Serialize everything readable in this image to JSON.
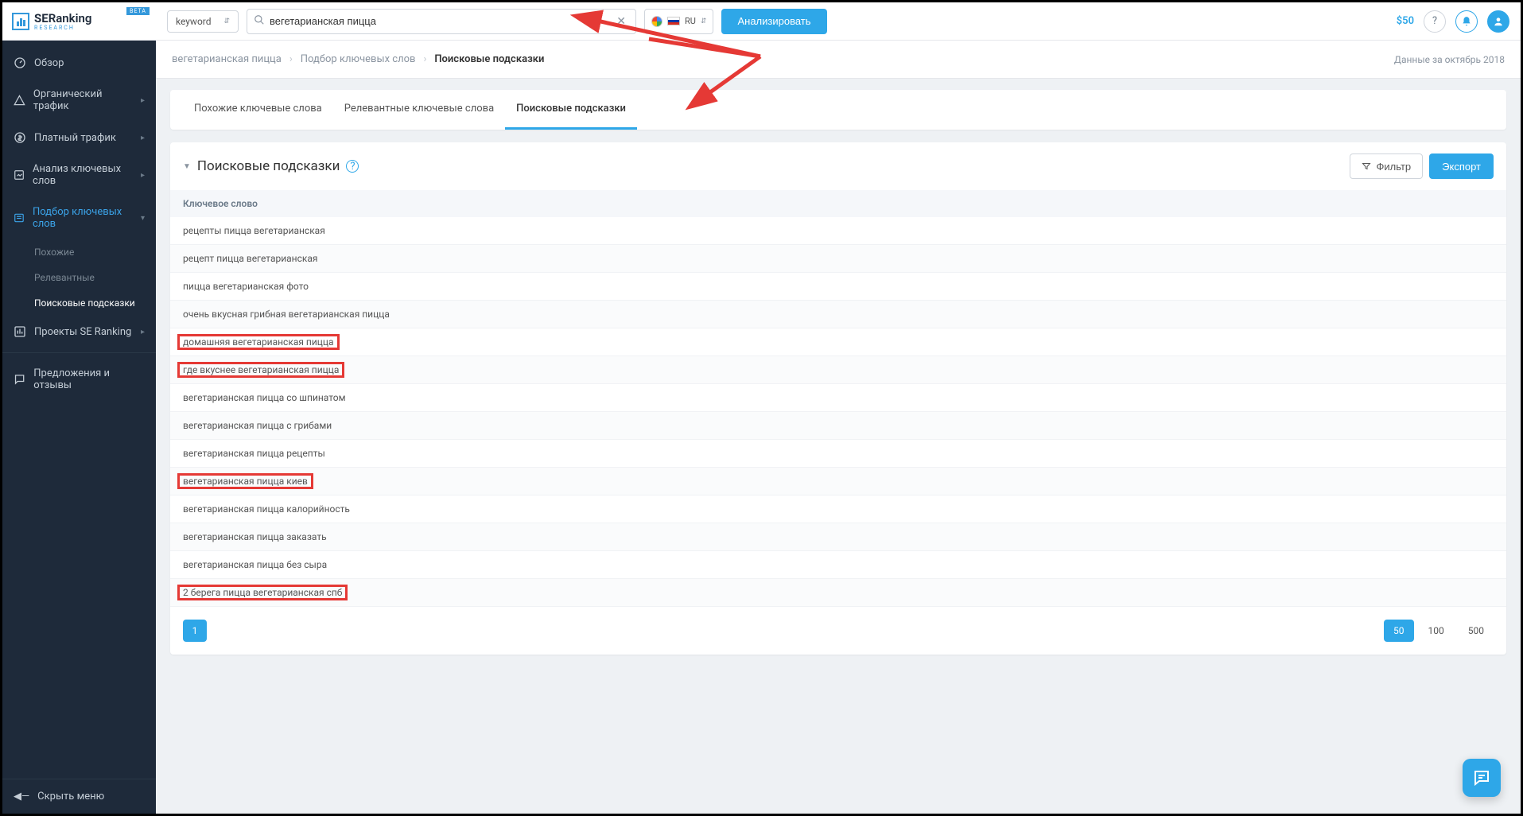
{
  "logo": {
    "brand": "SE",
    "brand2": "Ranking",
    "sub": "RESEARCH",
    "beta": "BETA"
  },
  "sidebar": {
    "items": [
      {
        "label": "Обзор"
      },
      {
        "label": "Органический трафик"
      },
      {
        "label": "Платный трафик"
      },
      {
        "label": "Анализ ключевых слов"
      },
      {
        "label": "Подбор ключевых слов"
      },
      {
        "label": "Проекты SE Ranking"
      },
      {
        "label": "Предложения и отзывы"
      }
    ],
    "sub_keyword": [
      {
        "label": "Похожие"
      },
      {
        "label": "Релевантные"
      },
      {
        "label": "Поисковые подсказки"
      }
    ],
    "collapse": "Скрыть меню"
  },
  "topbar": {
    "type_select": "keyword",
    "search_value": "вегетарианская пицца",
    "locale": "RU",
    "analyze": "Анализировать",
    "credit": "$50"
  },
  "breadcrumbs": {
    "items": [
      "вегетарианская пицца",
      "Подбор ключевых слов",
      "Поисковые подсказки"
    ],
    "date": "Данные за октябрь 2018"
  },
  "tabs": [
    "Похожие ключевые слова",
    "Релевантные ключевые слова",
    "Поисковые подсказки"
  ],
  "panel": {
    "title": "Поисковые подсказки",
    "filter": "Фильтр",
    "export": "Экспорт",
    "column": "Ключевое слово",
    "rows": [
      {
        "text": "рецепты пицца вегетарианская",
        "highlight": false
      },
      {
        "text": "рецепт пицца вегетарианская",
        "highlight": false
      },
      {
        "text": "пицца вегетарианская фото",
        "highlight": false
      },
      {
        "text": "очень вкусная грибная вегетарианская пицца",
        "highlight": false
      },
      {
        "text": "домашняя вегетарианская пицца",
        "highlight": true
      },
      {
        "text": "где вкуснее вегетарианская пицца",
        "highlight": true
      },
      {
        "text": "вегетарианская пицца со шпинатом",
        "highlight": false
      },
      {
        "text": "вегетарианская пицца с грибами",
        "highlight": false
      },
      {
        "text": "вегетарианская пицца рецепты",
        "highlight": false
      },
      {
        "text": "вегетарианская пицца киев",
        "highlight": true
      },
      {
        "text": "вегетарианская пицца калорийность",
        "highlight": false
      },
      {
        "text": "вегетарианская пицца заказать",
        "highlight": false
      },
      {
        "text": "вегетарианская пицца без сыра",
        "highlight": false
      },
      {
        "text": "2 берега пицца вегетарианская спб",
        "highlight": true
      }
    ]
  },
  "pagination": {
    "current": "1",
    "sizes": [
      "50",
      "100",
      "500"
    ],
    "active_size": "50"
  }
}
